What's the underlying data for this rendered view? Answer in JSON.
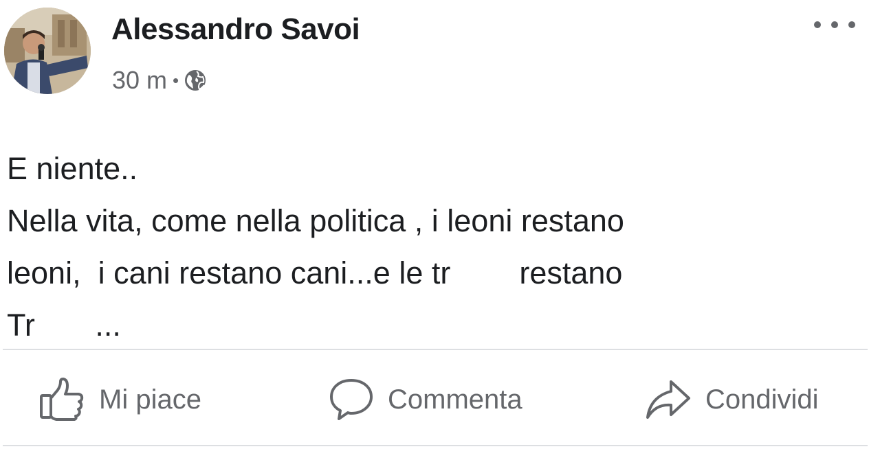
{
  "post": {
    "author": "Alessandro Savoi",
    "time": "30 m",
    "separator": "•",
    "privacy_icon": "globe-icon",
    "more_icon": "more-options-icon",
    "text_lines": [
      "E niente..",
      "Nella vita, come nella politica , i leoni restano",
      "leoni,  i cani restano cani...e le tr        restano",
      "Tr       ..."
    ]
  },
  "actions": {
    "like_label": "Mi piace",
    "comment_label": "Commenta",
    "share_label": "Condividi",
    "like_icon": "thumbs-up-icon",
    "comment_icon": "comment-bubble-icon",
    "share_icon": "share-arrow-icon"
  },
  "colors": {
    "text": "#1c1e21",
    "secondary": "#65676b",
    "divider": "#dddfe2"
  }
}
